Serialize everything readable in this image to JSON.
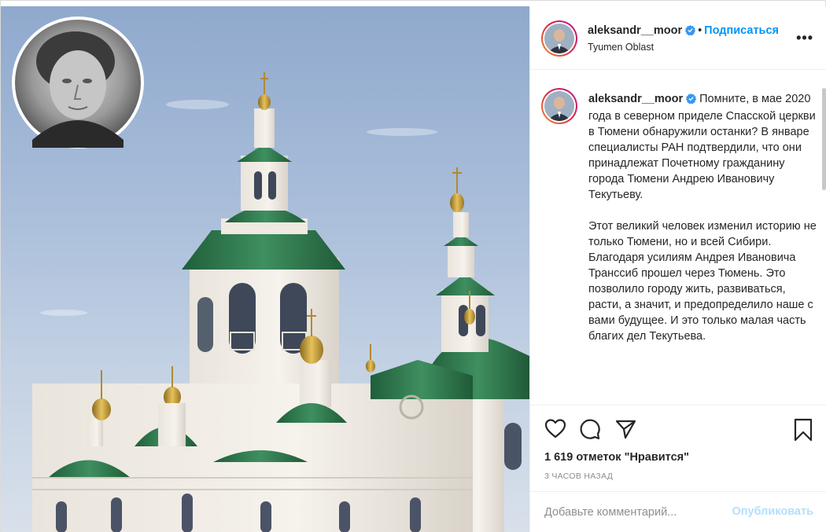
{
  "post": {
    "username": "aleksandr__moor",
    "follow_label": "Подписаться",
    "dot": "•",
    "location": "Tyumen Oblast",
    "more_label": "•••"
  },
  "caption": {
    "username": "aleksandr__moor",
    "paragraph1": "Помните, в мае 2020 года в северном приделе Спасской церкви в Тюмени обнаружили останки? В январе специалисты РАН подтвердили, что они принадлежат Почетному гражданину города Тюмени Андрею Ивановичу Текутьеву.",
    "paragraph2": "Этот великий человек изменил историю не только Тюмени, но и всей Сибири. Благодаря усилиям Андрея Ивановича Транссиб прошел через Тюмень. Это позволило городу жить, развиваться, расти, а значит, и предопределило наше с вами будущее. И это только малая часть благих дел Текутьева."
  },
  "actions": {
    "icons": [
      "heart-icon",
      "comment-icon",
      "share-icon",
      "bookmark-icon"
    ],
    "likes": "1 619 отметок \"Нравится\"",
    "time": "3 часов назад"
  },
  "comment": {
    "placeholder": "Добавьте комментарий...",
    "publish_label": "Опубликовать"
  },
  "colors": {
    "accent": "#0095f6",
    "publish_disabled": "#b2dffc",
    "verified": "#3897f0",
    "roof_green": "#2e7d4f",
    "gold": "#c9a23b"
  }
}
